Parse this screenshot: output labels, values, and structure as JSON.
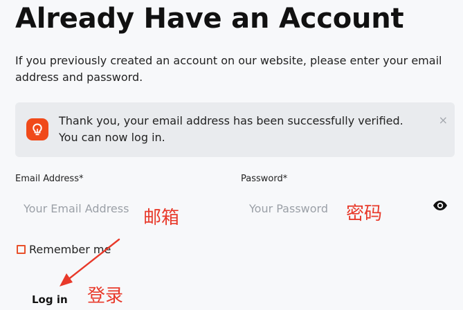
{
  "page": {
    "title": "Already Have an Account",
    "intro": "If you previously created an account on our website, please enter your email address and password."
  },
  "alert": {
    "line1": "Thank you, your email address has been successfully verified.",
    "line2": "You can now log in.",
    "close": "×",
    "icon": "lightbulb-icon",
    "icon_color": "#f04a1a"
  },
  "form": {
    "email_label": "Email Address*",
    "email_placeholder": "Your Email Address",
    "password_label": "Password*",
    "password_placeholder": "Your Password",
    "remember_label": "Remember me",
    "login_label": "Log in"
  },
  "annotations": {
    "email_note": "邮箱",
    "password_note": "密码",
    "login_note": "登录",
    "color": "#e8392a"
  }
}
